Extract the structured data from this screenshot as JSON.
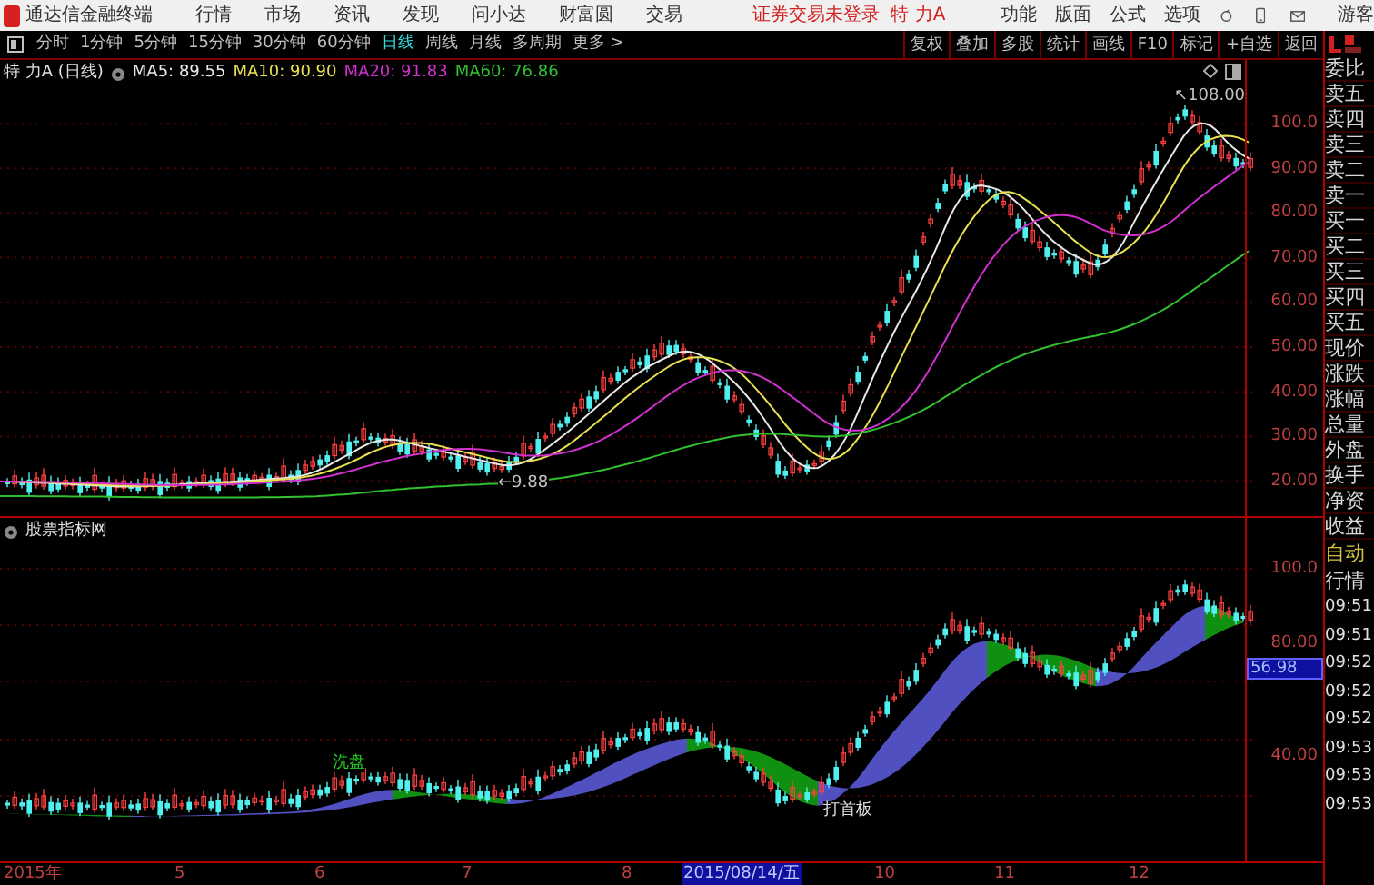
{
  "title_bar": {
    "app_name": "通达信金融终端",
    "menus": [
      "行情",
      "市场",
      "资讯",
      "发现",
      "问小达",
      "财富圆",
      "交易"
    ],
    "login_status": "证券交易未登录",
    "security": "特 力A",
    "right_menus": [
      "功能",
      "版面",
      "公式",
      "选项"
    ],
    "user": "游客"
  },
  "periods": [
    {
      "label": "分时",
      "selected": false
    },
    {
      "label": "1分钟",
      "selected": false
    },
    {
      "label": "5分钟",
      "selected": false
    },
    {
      "label": "15分钟",
      "selected": false
    },
    {
      "label": "30分钟",
      "selected": false
    },
    {
      "label": "60分钟",
      "selected": false
    },
    {
      "label": "日线",
      "selected": true
    },
    {
      "label": "周线",
      "selected": false
    },
    {
      "label": "月线",
      "selected": false
    },
    {
      "label": "多周期",
      "selected": false
    },
    {
      "label": "更多 >",
      "selected": false
    }
  ],
  "tools": [
    "复权",
    "叠加",
    "多股",
    "统计",
    "画线",
    "F10",
    "标记",
    "+自选",
    "返回"
  ],
  "main_chart": {
    "security": "特 力A",
    "period": "(日线)",
    "ma": [
      {
        "label": "MA5: 89.55",
        "color": "#e8e8e8"
      },
      {
        "label": "MA10: 90.90",
        "color": "#e8e050"
      },
      {
        "label": "MA20: 91.83",
        "color": "#d030d0"
      },
      {
        "label": "MA60: 76.86",
        "color": "#30c030"
      }
    ],
    "high_label": "↖108.00",
    "low_label": "←9.88",
    "axis": [
      "100.0",
      "90.00",
      "80.00",
      "70.00",
      "60.00",
      "50.00",
      "40.00",
      "30.00",
      "20.00"
    ]
  },
  "indicator": {
    "title": "股票指标网",
    "marks": [
      {
        "text": "洗盘",
        "color": "#20d020"
      },
      {
        "text": "打首板",
        "color": "#e0e0e0"
      }
    ],
    "axis": [
      {
        "label": "100.0",
        "selected": false
      },
      {
        "label": "80.00",
        "selected": false
      },
      {
        "label": "56.98",
        "selected": true
      },
      {
        "label": "40.00",
        "selected": false
      }
    ]
  },
  "date_axis": [
    {
      "label": "2015年",
      "selected": false
    },
    {
      "label": "5",
      "selected": false
    },
    {
      "label": "6",
      "selected": false
    },
    {
      "label": "7",
      "selected": false
    },
    {
      "label": "8",
      "selected": false
    },
    {
      "label": "2015/08/14/五",
      "selected": true
    },
    {
      "label": "10",
      "selected": false
    },
    {
      "label": "11",
      "selected": false
    },
    {
      "label": "12",
      "selected": false
    }
  ],
  "quote_panel": {
    "fields": [
      "委比",
      "卖五",
      "卖四",
      "卖三",
      "卖二",
      "卖一",
      "买一",
      "买二",
      "买三",
      "买四",
      "买五",
      "现价",
      "涨跌",
      "涨幅",
      "总量",
      "外盘",
      "换手",
      "净资",
      "收益"
    ],
    "tabs": [
      {
        "label": "自动",
        "selected": true
      },
      {
        "label": "行情",
        "selected": false
      }
    ],
    "times": [
      "09:51",
      "09:51",
      "09:52",
      "09:52",
      "09:52",
      "09:53",
      "09:53",
      "09:53"
    ]
  }
}
